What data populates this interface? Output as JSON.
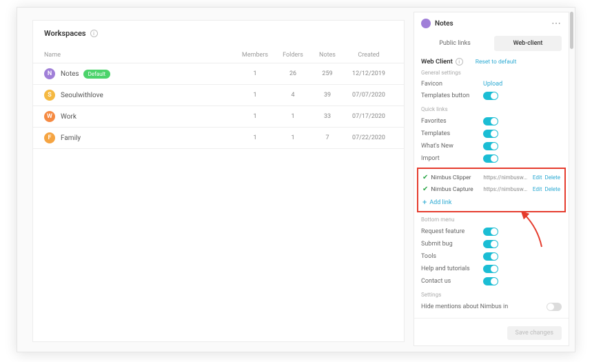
{
  "main": {
    "title": "Workspaces",
    "columns": {
      "name": "Name",
      "members": "Members",
      "folders": "Folders",
      "notes": "Notes",
      "created": "Created"
    },
    "rows": [
      {
        "letter": "N",
        "iconClass": "ws-purple",
        "name": "Notes",
        "badge": "Default",
        "members": "1",
        "folders": "26",
        "notes": "259",
        "created": "12/12/2019"
      },
      {
        "letter": "S",
        "iconClass": "ws-yellow",
        "name": "Seoulwithlove",
        "members": "1",
        "folders": "4",
        "notes": "39",
        "created": "07/07/2020"
      },
      {
        "letter": "W",
        "iconClass": "ws-orange",
        "name": "Work",
        "members": "1",
        "folders": "1",
        "notes": "33",
        "created": "07/17/2020"
      },
      {
        "letter": "F",
        "iconClass": "ws-amber",
        "name": "Family",
        "members": "1",
        "folders": "1",
        "notes": "7",
        "created": "07/22/2020"
      }
    ]
  },
  "panel": {
    "title": "Notes",
    "tabs": {
      "public": "Public links",
      "web": "Web-client"
    },
    "section": "Web Client",
    "reset": "Reset to default",
    "groups": {
      "general": "General settings",
      "quicklinks": "Quick links",
      "bottommenu": "Bottom menu",
      "settings": "Settings"
    },
    "favicon_label": "Favicon",
    "favicon_value": "Upload",
    "templates_label": "Templates button",
    "toggles": {
      "favorites": "Favorites",
      "templates": "Templates",
      "whatsnew": "What's New",
      "import": "Import",
      "request": "Request feature",
      "submit": "Submit bug",
      "tools": "Tools",
      "help": "Help and tutorials",
      "contact": "Contact us",
      "hide": "Hide mentions about Nimbus in"
    },
    "links": [
      {
        "name": "Nimbus Clipper",
        "url": "https://nimbusweb.me/clip…"
      },
      {
        "name": "Nimbus Capture",
        "url": "https://nimbusweb.me/scre…"
      }
    ],
    "link_actions": {
      "edit": "Edit",
      "delete": "Delete"
    },
    "add_link": "Add link",
    "save": "Save changes"
  }
}
